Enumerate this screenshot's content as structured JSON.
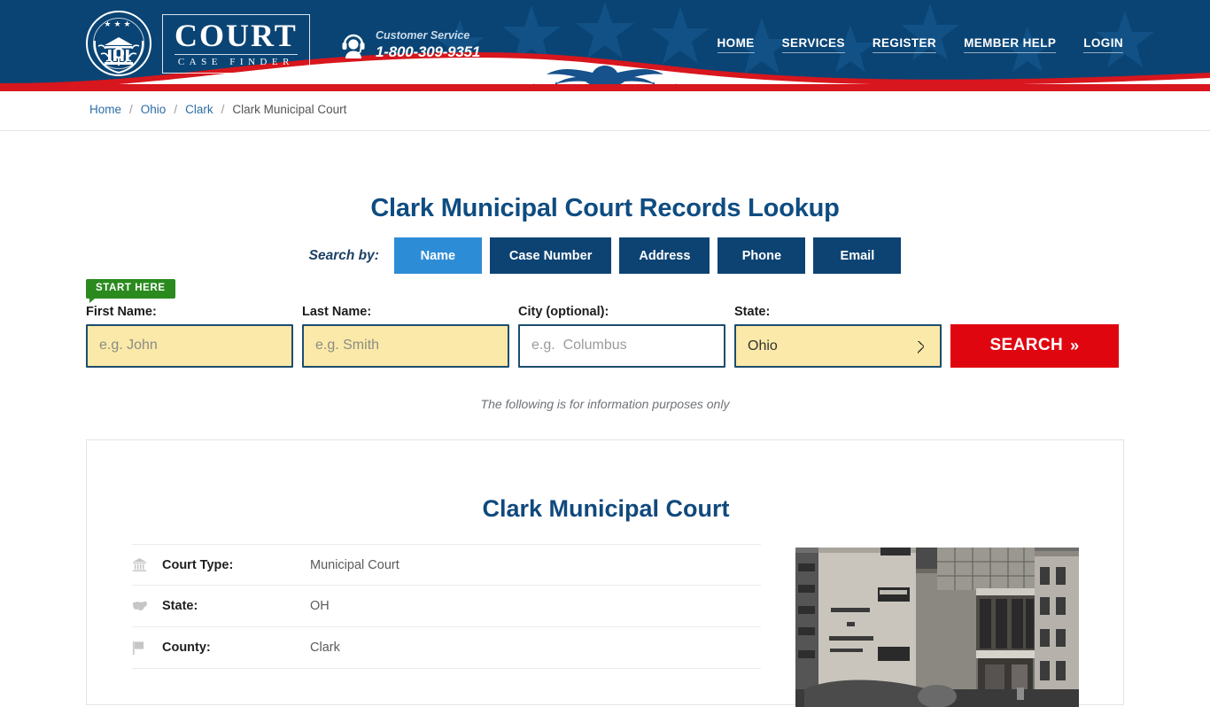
{
  "header": {
    "logo": {
      "main": "COURT",
      "sub": "CASE FINDER"
    },
    "customer_service": {
      "label": "Customer Service",
      "phone": "1-800-309-9351",
      "icon": "headset-support-icon"
    },
    "nav": [
      {
        "label": "HOME"
      },
      {
        "label": "SERVICES"
      },
      {
        "label": "REGISTER"
      },
      {
        "label": "MEMBER HELP"
      },
      {
        "label": "LOGIN"
      }
    ],
    "colors": {
      "bg": "#0a4474",
      "red": "#d8161d"
    }
  },
  "breadcrumb": {
    "items": [
      {
        "label": "Home",
        "link": true
      },
      {
        "label": "Ohio",
        "link": true
      },
      {
        "label": "Clark",
        "link": true
      },
      {
        "label": "Clark Municipal Court",
        "link": false
      }
    ],
    "separator": "/"
  },
  "main": {
    "page_title": "Clark Municipal Court Records Lookup",
    "search_by_label": "Search by:",
    "tabs": [
      {
        "label": "Name",
        "active": true
      },
      {
        "label": "Case Number",
        "active": false
      },
      {
        "label": "Address",
        "active": false
      },
      {
        "label": "Phone",
        "active": false
      },
      {
        "label": "Email",
        "active": false
      }
    ],
    "start_here_badge": "START HERE",
    "form": {
      "first_name": {
        "label": "First Name:",
        "placeholder": "e.g. John",
        "value": ""
      },
      "last_name": {
        "label": "Last Name:",
        "placeholder": "e.g. Smith",
        "value": ""
      },
      "city": {
        "label": "City (optional):",
        "placeholder": "e.g.  Columbus",
        "value": ""
      },
      "state": {
        "label": "State:",
        "value": "Ohio"
      },
      "search_button": "SEARCH",
      "search_button_chevron": "»"
    },
    "info_note": "The following is for information purposes only"
  },
  "card": {
    "title": "Clark Municipal Court",
    "details": [
      {
        "icon": "courthouse-icon",
        "label": "Court Type:",
        "value": "Municipal Court"
      },
      {
        "icon": "us-map-icon",
        "label": "State:",
        "value": "OH"
      },
      {
        "icon": "flag-icon",
        "label": "County:",
        "value": "Clark"
      }
    ],
    "photo_alt": "courthouse-building-photo"
  },
  "colors": {
    "brand_blue": "#0a4474",
    "accent_blue": "#2d8cd6",
    "red": "#e00610",
    "green": "#2a8a1e",
    "input_yellow": "#fae9a8"
  }
}
